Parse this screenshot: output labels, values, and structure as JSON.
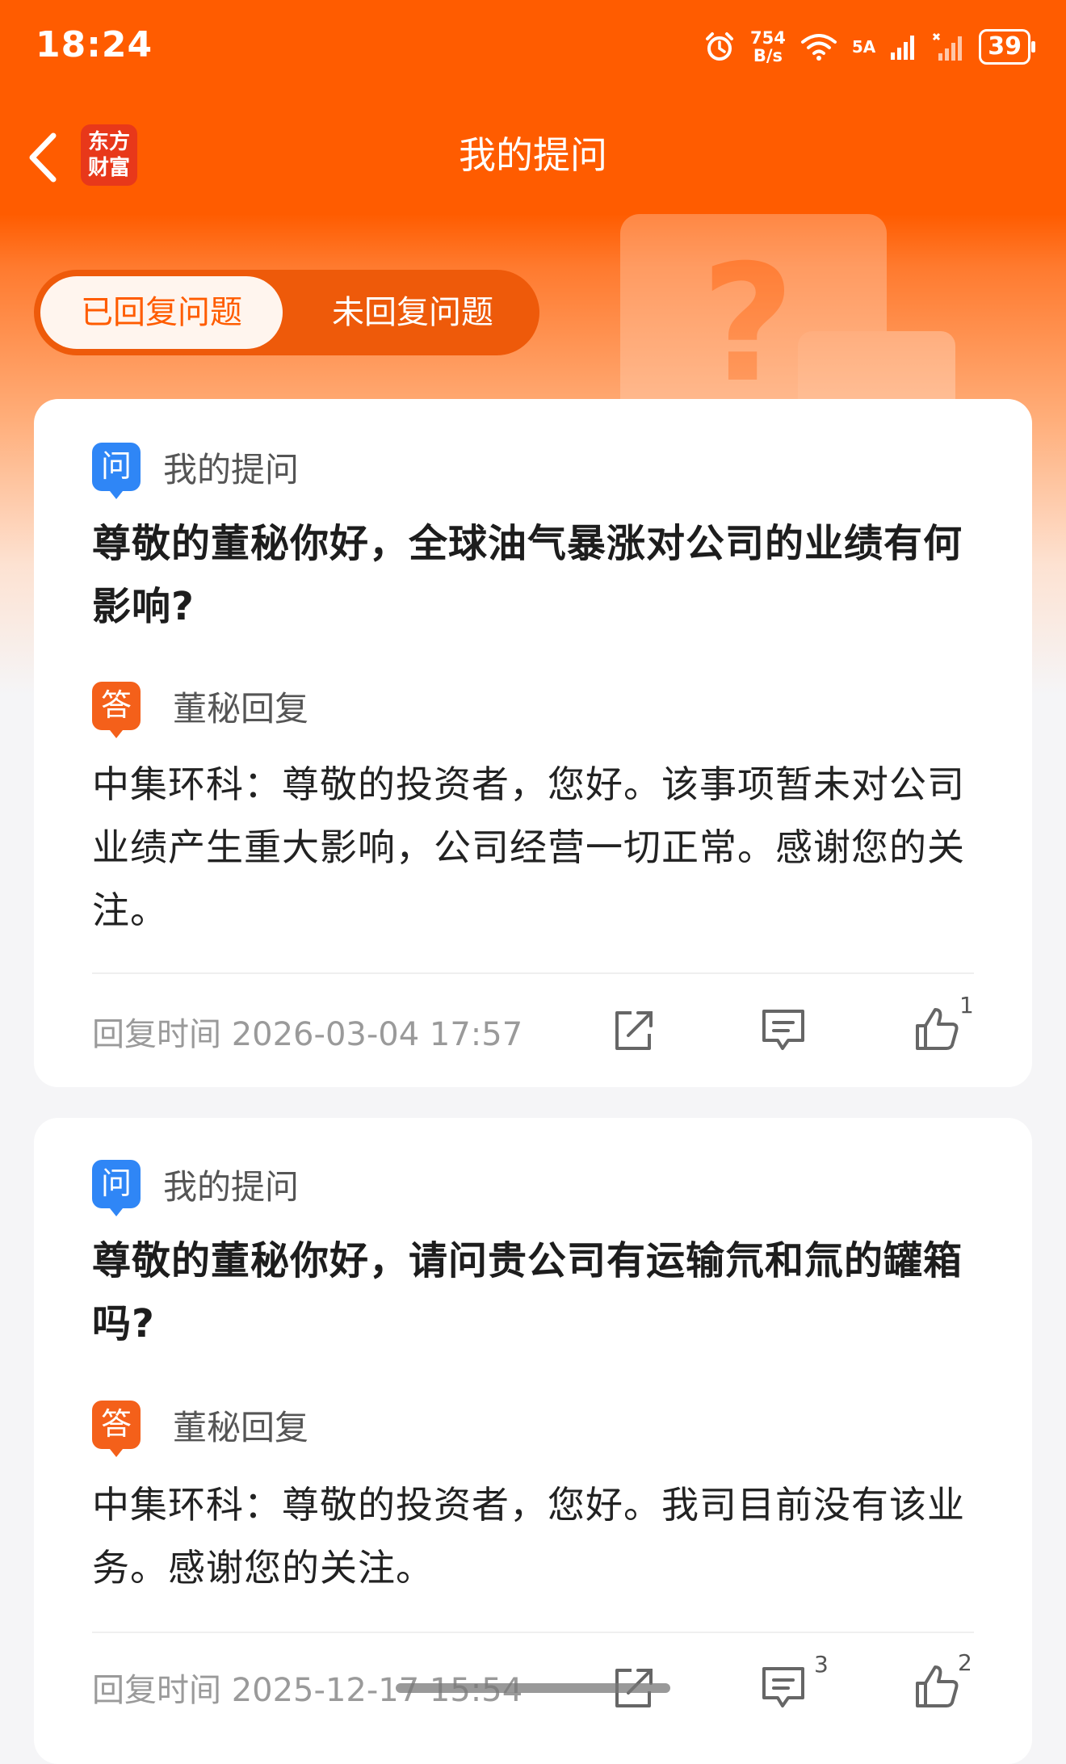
{
  "status": {
    "time": "18:24",
    "speed_value": "754",
    "speed_unit": "B/s",
    "network": "5A",
    "battery": "39"
  },
  "nav": {
    "title": "我的提问",
    "logo_line1": "东方",
    "logo_line2": "财富"
  },
  "tabs": [
    {
      "label": "已回复问题",
      "active": true
    },
    {
      "label": "未回复问题",
      "active": false
    }
  ],
  "questions": [
    {
      "q_icon": "问",
      "q_label": "我的提问",
      "question": "尊敬的董秘你好，全球油气暴涨对公司的业绩有何影响?",
      "a_icon": "答",
      "a_label": "董秘回复",
      "answer": "中集环科：尊敬的投资者，您好。该事项暂未对公司业绩产生重大影响，公司经营一切正常。感谢您的关注。",
      "reply_time": "回复时间 2026-03-04 17:57",
      "comment_count": "",
      "like_count": "1"
    },
    {
      "q_icon": "问",
      "q_label": "我的提问",
      "question": "尊敬的董秘你好，请问贵公司有运输氘和氚的罐箱吗?",
      "a_icon": "答",
      "a_label": "董秘回复",
      "answer": "中集环科：尊敬的投资者，您好。我司目前没有该业务。感谢您的关注。",
      "reply_time": "回复时间 2025-12-17 15:54",
      "comment_count": "3",
      "like_count": "2"
    }
  ],
  "colors": {
    "brand": "#ff5c00",
    "question_icon": "#2f86f6",
    "answer_icon": "#f4601a"
  },
  "icons": [
    "back-arrow-icon",
    "alarm-icon",
    "wifi-icon",
    "signal-icon",
    "share-icon",
    "comment-icon",
    "like-icon"
  ]
}
